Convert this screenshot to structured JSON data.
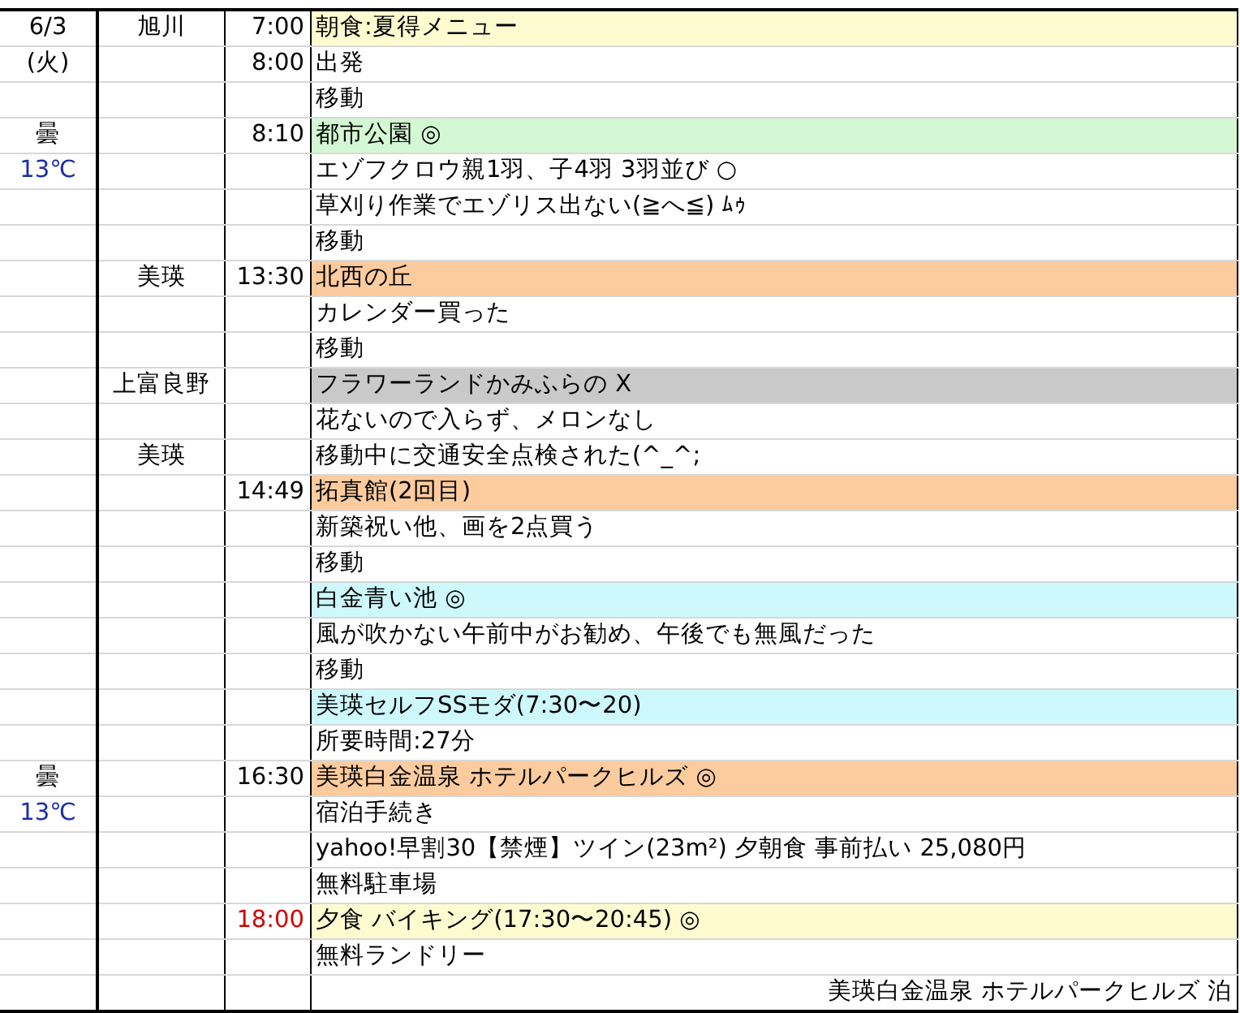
{
  "rows": [
    {
      "info": "6/3",
      "place": "旭川",
      "time": "7:00",
      "text": "朝食:夏得メニュー",
      "kind": "entry",
      "color": "#fffbd0"
    },
    {
      "info": "(火)",
      "time": "8:00",
      "text": "出発",
      "kind": "entry"
    },
    {
      "text": "移動",
      "kind": "entry"
    },
    {
      "info": "曇",
      "time": "8:10",
      "text": "都市公園 ◎",
      "kind": "entry",
      "color": "#d3f8d3"
    },
    {
      "info": {
        "text": "13℃",
        "color": "#1a2fa8"
      },
      "text": "エゾフクロウ親1羽、子4羽 3羽並び ○",
      "kind": "entry"
    },
    {
      "text": "草刈り作業でエゾリス出ない(≧へ≦) ﾑｩ",
      "kind": "entry"
    },
    {
      "text": "移動",
      "kind": "entry"
    },
    {
      "place": "美瑛",
      "time": "13:30",
      "text": "北西の丘",
      "kind": "entry",
      "color": "#fccb9e"
    },
    {
      "text": "カレンダー買った",
      "kind": "entry"
    },
    {
      "text": "移動",
      "kind": "entry"
    },
    {
      "place": "上富良野",
      "text": "フラワーランドかみふらの X",
      "kind": "entry",
      "color": "#c9c9c9"
    },
    {
      "text": "花ないので入らず、メロンなし",
      "kind": "entry"
    },
    {
      "place": "美瑛",
      "text": "移動中に交通安全点検された(^_^;",
      "kind": "entry"
    },
    {
      "time": "14:49",
      "text": "拓真館(2回目)",
      "kind": "entry",
      "color": "#fccb9e"
    },
    {
      "text": "新築祝い他、画を2点買う",
      "kind": "entry"
    },
    {
      "text": "移動",
      "kind": "entry"
    },
    {
      "text": "白金青い池 ◎",
      "kind": "entry",
      "color": "#cdf8fc"
    },
    {
      "text": "風が吹かない午前中がお勧め、午後でも無風だった",
      "kind": "entry"
    },
    {
      "text": "移動",
      "kind": "entry"
    },
    {
      "text": "美瑛セルフSSモダ(7:30〜20)",
      "kind": "entry",
      "color": "#cdf8fc"
    },
    {
      "text": "所要時間:27分",
      "kind": "entry"
    },
    {
      "info": "曇",
      "time": "16:30",
      "text": "美瑛白金温泉 ホテルパークヒルズ ◎",
      "kind": "entry",
      "color": "#fccb9e"
    },
    {
      "info": {
        "text": "13℃",
        "color": "#1a2fa8"
      },
      "text": "宿泊手続き",
      "kind": "entry"
    },
    {
      "text": "yahoo!早割30【禁煙】ツイン(23m²) 夕朝食 事前払い 25,080円",
      "kind": "entry"
    },
    {
      "text": "無料駐車場",
      "kind": "entry"
    },
    {
      "time": {
        "text": "18:00",
        "color": "#d00000"
      },
      "text": "夕食 バイキング(17:30〜20:45) ◎",
      "kind": "entry",
      "color": "#fffbd0"
    },
    {
      "text": "無料ランドリー",
      "kind": "entry"
    },
    {
      "text": "美瑛白金温泉 ホテルパークヒルズ 泊",
      "kind": "lodging"
    }
  ]
}
